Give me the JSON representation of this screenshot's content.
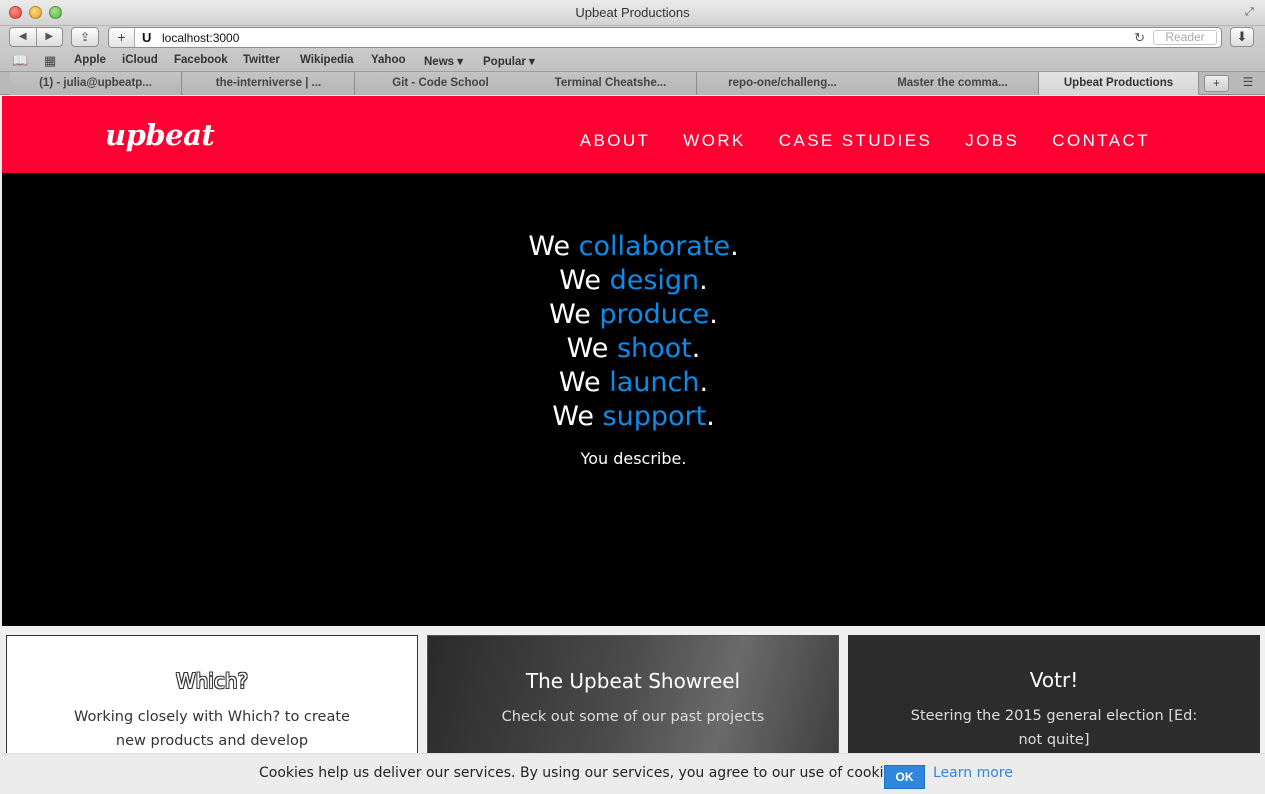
{
  "window": {
    "title": "Upbeat Productions",
    "icons": {
      "close": "close-icon",
      "minimize": "minimize-icon",
      "zoom": "zoom-icon",
      "fullscreen": "fullscreen-icon"
    }
  },
  "toolbar": {
    "back": "◀",
    "forward": "▶",
    "share": "⇪",
    "add": "+",
    "favicon": "U",
    "url": "localhost:3000",
    "reload": "↻",
    "reader": "Reader",
    "downloads": "⬇"
  },
  "bookmarks": [
    "Apple",
    "iCloud",
    "Facebook",
    "Twitter",
    "Wikipedia",
    "Yahoo",
    "News ▾",
    "Popular ▾"
  ],
  "tabs": [
    {
      "label": "(1) - julia@upbeatp..."
    },
    {
      "label": "the-interniverse | ..."
    },
    {
      "label": "Git - Code School"
    },
    {
      "label": "Terminal Cheatshe..."
    },
    {
      "label": "repo-one/challeng..."
    },
    {
      "label": "Master the comma..."
    },
    {
      "label": "Upbeat Productions"
    }
  ],
  "site": {
    "logo": "upbeat",
    "brand_color": "#ff0032",
    "accent_color": "#0d8be8",
    "nav": [
      "ABOUT",
      "WORK",
      "CASE STUDIES",
      "JOBS",
      "CONTACT"
    ],
    "hero": {
      "lines": [
        {
          "we": "We ",
          "verb": "collaborate",
          "end": "."
        },
        {
          "we": "We ",
          "verb": "design",
          "end": "."
        },
        {
          "we": "We ",
          "verb": "produce",
          "end": "."
        },
        {
          "we": "We ",
          "verb": "shoot",
          "end": "."
        },
        {
          "we": "We ",
          "verb": "launch",
          "end": "."
        },
        {
          "we": "We ",
          "verb": "support",
          "end": "."
        }
      ],
      "subline": "You describe."
    },
    "cards": [
      {
        "title": "Which?",
        "desc": "Working closely with Which? to create new products and develop"
      },
      {
        "title": "The Upbeat Showreel",
        "desc": "Check out some of our past projects"
      },
      {
        "title": "Votr!",
        "desc": "Steering the 2015 general election [Ed: not quite]"
      }
    ],
    "cookie": {
      "text": "Cookies help us deliver our services. By using our services, you agree to our use of cookies.",
      "ok": "OK",
      "learn_more": "Learn more"
    }
  }
}
